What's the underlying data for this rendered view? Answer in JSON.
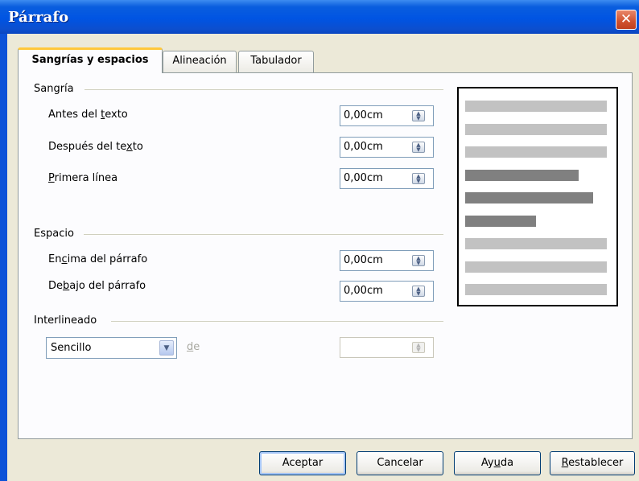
{
  "window": {
    "title": "Párrafo",
    "close_glyph": "✕"
  },
  "tabs": [
    {
      "label": "Sangrías y espacios",
      "active": true
    },
    {
      "label": "Alineación",
      "active": false
    },
    {
      "label": "Tabulador",
      "active": false
    }
  ],
  "indent": {
    "section_label": "Sangría",
    "fields": [
      {
        "pre": "Antes del ",
        "key": "t",
        "post": "exto",
        "value": "0,00cm"
      },
      {
        "pre": "Después del te",
        "key": "x",
        "post": "to",
        "value": "0,00cm"
      },
      {
        "pre": "",
        "key": "P",
        "post": "rimera línea",
        "value": "0,00cm"
      }
    ]
  },
  "spacing": {
    "section_label": "Espacio",
    "fields": [
      {
        "pre": "En",
        "key": "c",
        "post": "ima del párrafo",
        "value": "0,00cm"
      },
      {
        "pre": "De",
        "key": "b",
        "post": "ajo del párrafo",
        "value": "0,00cm"
      }
    ]
  },
  "line_spacing": {
    "section_label": "Interlineado",
    "selected": "Sencillo",
    "of_label_key": "d",
    "of_label_rest": "e",
    "of_value": ""
  },
  "preview": {
    "lines": [
      {
        "width": 0.9,
        "shade": "light"
      },
      {
        "width": 0.9,
        "shade": "light"
      },
      {
        "width": 0.9,
        "shade": "light"
      },
      {
        "width": 0.72,
        "shade": "dark"
      },
      {
        "width": 0.81,
        "shade": "dark"
      },
      {
        "width": 0.45,
        "shade": "dark"
      },
      {
        "width": 0.9,
        "shade": "light"
      },
      {
        "width": 0.9,
        "shade": "light"
      },
      {
        "width": 0.9,
        "shade": "light"
      }
    ],
    "colors": {
      "light": "#c2c2c2",
      "dark": "#808080"
    }
  },
  "buttons": {
    "ok": "Aceptar",
    "cancel": "Cancelar",
    "help_pre": "Ay",
    "help_key": "u",
    "help_post": "da",
    "reset_key": "R",
    "reset_post": "establecer"
  },
  "colors": {
    "titlebar": "#0054e3",
    "tab_highlight": "#ffc83c",
    "dialog_bg": "#ece9d8"
  }
}
